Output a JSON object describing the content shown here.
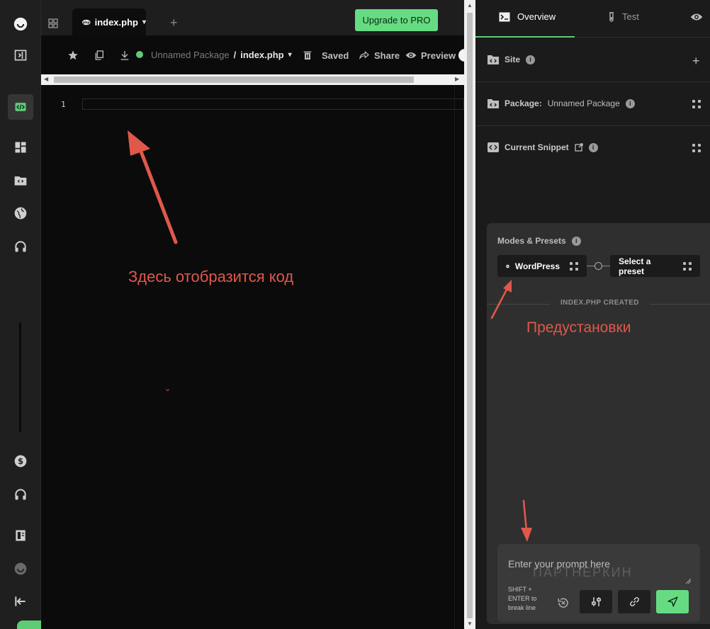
{
  "editor": {
    "tab_label": "index.php",
    "upgrade_label": "Upgrade to PRO",
    "toolbar": {
      "package_name": "Unnamed Package",
      "separator": "/",
      "file_name": "index.php",
      "saved_label": "Saved",
      "share_label": "Share",
      "preview_label": "Preview"
    },
    "line_number": "1",
    "annotation_code": "Здесь отобразится код"
  },
  "panel": {
    "tabs": [
      "Overview",
      "Test"
    ],
    "sections": {
      "site_label": "Site",
      "package_label": "Package:",
      "package_value": "Unnamed Package",
      "snippet_label": "Current Snippet"
    },
    "modes": {
      "title": "Modes & Presets",
      "mode_button": "WordPress",
      "preset_button": "Select a preset",
      "created_text": "INDEX.PHP CREATED",
      "annotation_presets": "Предустановки"
    },
    "prompt": {
      "placeholder": "Enter your prompt here",
      "hint": "SHIFT + ENTER to break line",
      "watermark": "ПАРТНЕРКИН"
    }
  },
  "colors": {
    "accent_green": "#66dc82",
    "annotation_red": "#e0584a"
  }
}
